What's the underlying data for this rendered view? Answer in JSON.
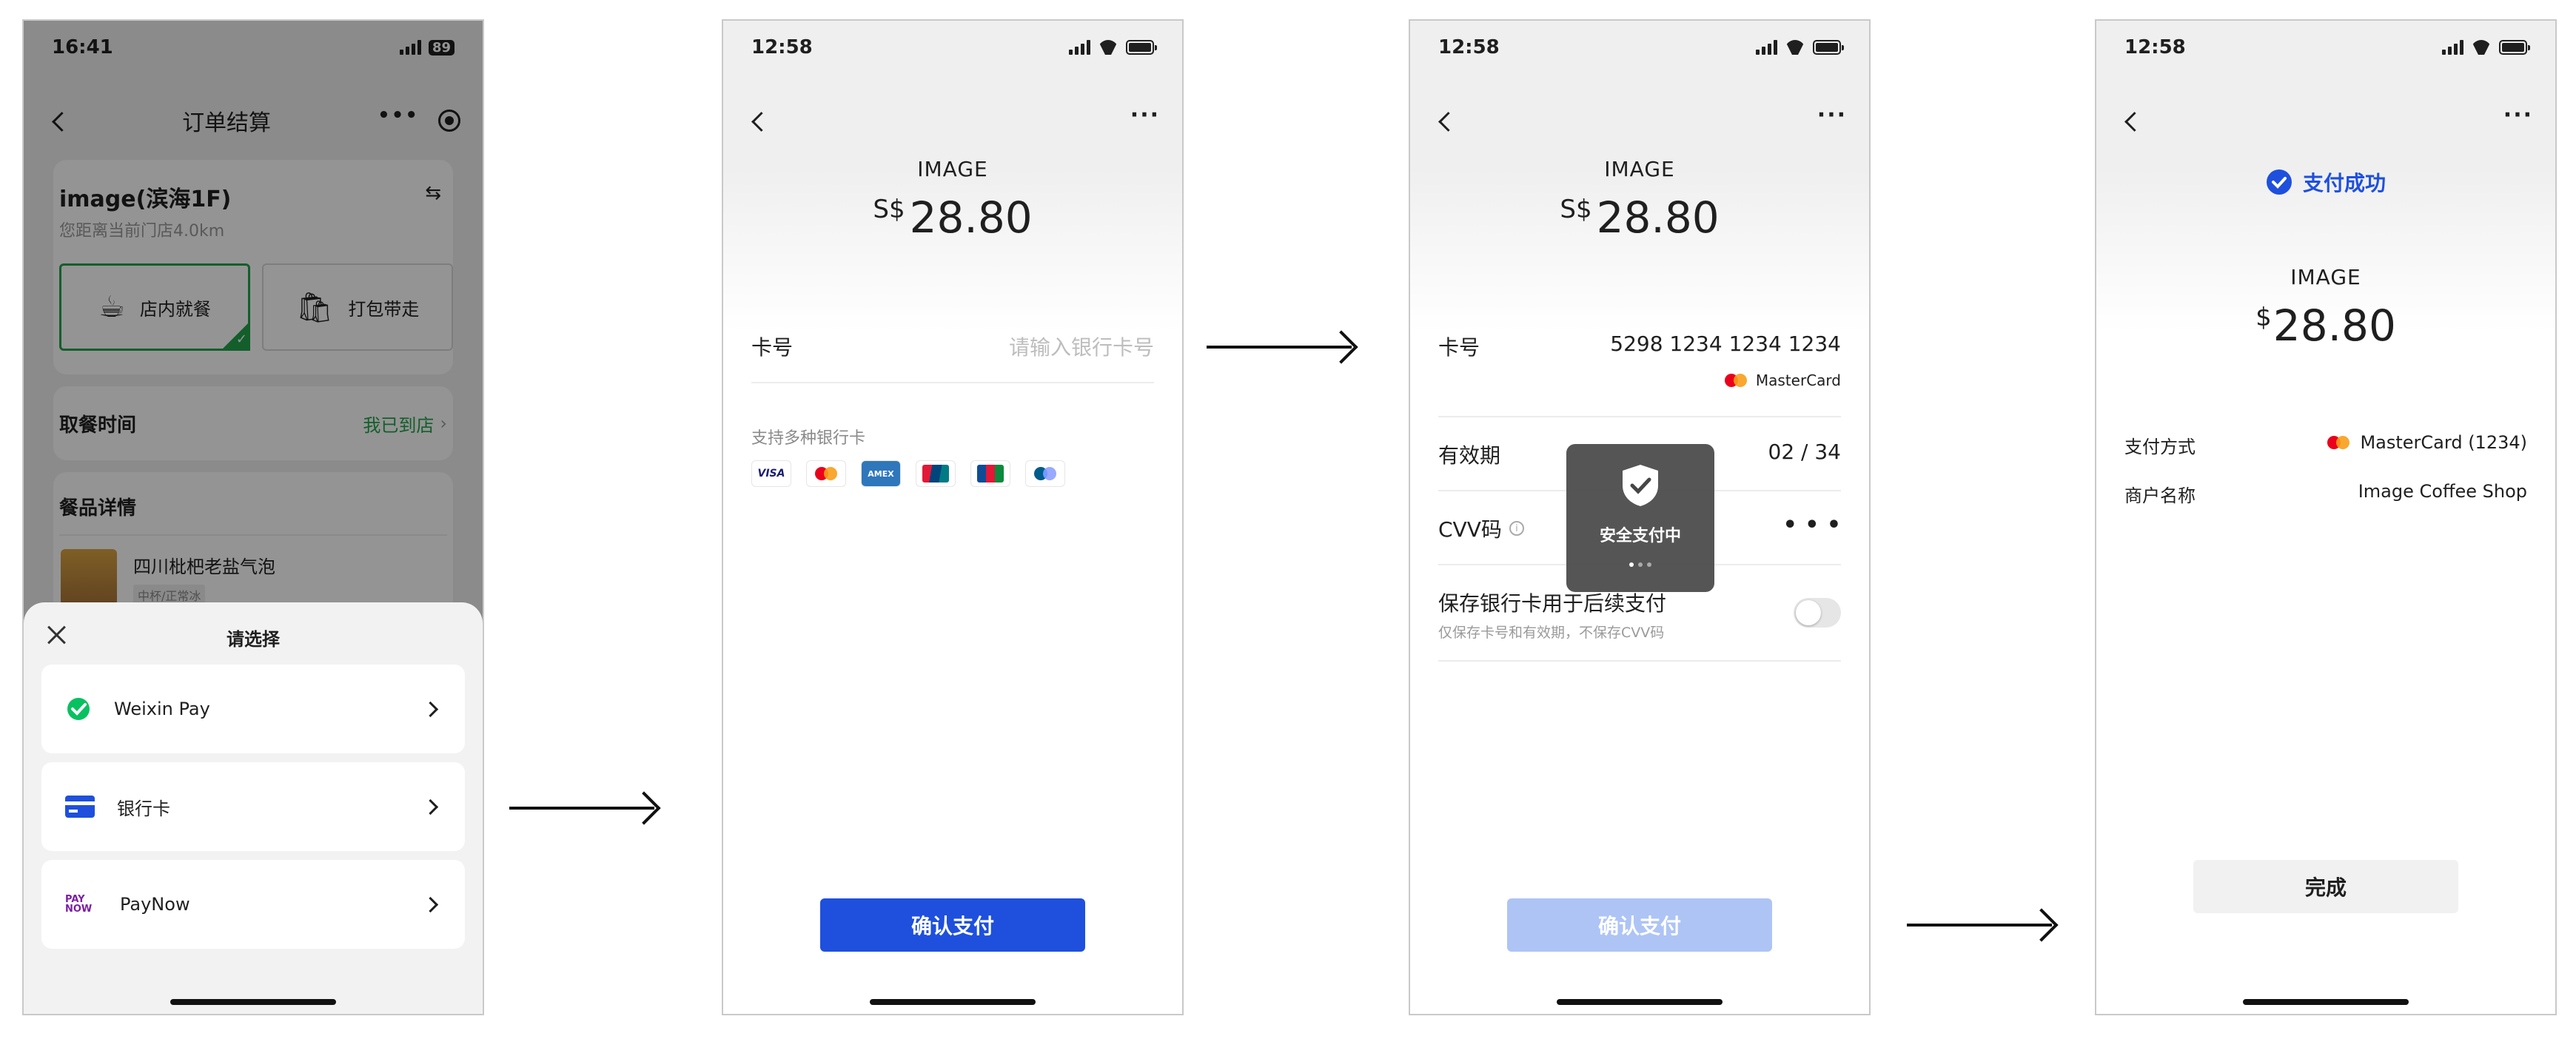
{
  "screen1": {
    "status_time": "16:41",
    "battery": "89",
    "nav_title": "订单结算",
    "store_name": "image(滨海1F)",
    "store_distance": "您距离当前门店4.0km",
    "dine_in": "店内就餐",
    "take_out": "打包带走",
    "pickup_label": "取餐时间",
    "pickup_value": "我已到店",
    "meal_details": "餐品详情",
    "item_name": "四川枇杷老盐气泡",
    "item_spec": "中杯/正常冰",
    "sheet_title": "请选择",
    "options": [
      {
        "label": "Weixin Pay",
        "icon": "wechat-pay-icon"
      },
      {
        "label": "银行卡",
        "icon": "bank-card-icon"
      },
      {
        "label": "PayNow",
        "icon": "paynow-icon"
      }
    ],
    "paynow_logo_top": "PAY",
    "paynow_logo_bottom": "NOW"
  },
  "screen2": {
    "status_time": "12:58",
    "merchant": "IMAGE",
    "currency": "S$",
    "amount": "28.80",
    "card_label": "卡号",
    "card_placeholder": "请输入银行卡号",
    "supported_text": "支持多种银行卡",
    "brands": [
      "VISA",
      "mastercard",
      "AMEX",
      "UnionPay",
      "JCB",
      "maestro"
    ],
    "confirm": "确认支付"
  },
  "screen3": {
    "status_time": "12:58",
    "merchant": "IMAGE",
    "currency": "S$",
    "amount": "28.80",
    "card_label": "卡号",
    "card_number": "5298 1234 1234 1234",
    "card_brand": "MasterCard",
    "expiry_label": "有效期",
    "expiry_value": "02 / 34",
    "cvv_label": "CVV码",
    "cvv_value": "• • •",
    "save_label": "保存银行卡用于后续支付",
    "save_hint": "仅保存卡号和有效期，不保存CVV码",
    "toast_text": "安全支付中",
    "confirm": "确认支付"
  },
  "screen4": {
    "status_time": "12:58",
    "success_text": "支付成功",
    "merchant": "IMAGE",
    "currency": "$",
    "amount": "28.80",
    "method_label": "支付方式",
    "method_value": "MasterCard (1234)",
    "merchant_label": "商户名称",
    "merchant_value": "Image Coffee Shop",
    "done": "完成"
  },
  "colors": {
    "primary": "#1e50dd",
    "primary_disabled": "#aec4f5",
    "wechat_green": "#07c160",
    "dine_in_green": "#22a34a"
  }
}
